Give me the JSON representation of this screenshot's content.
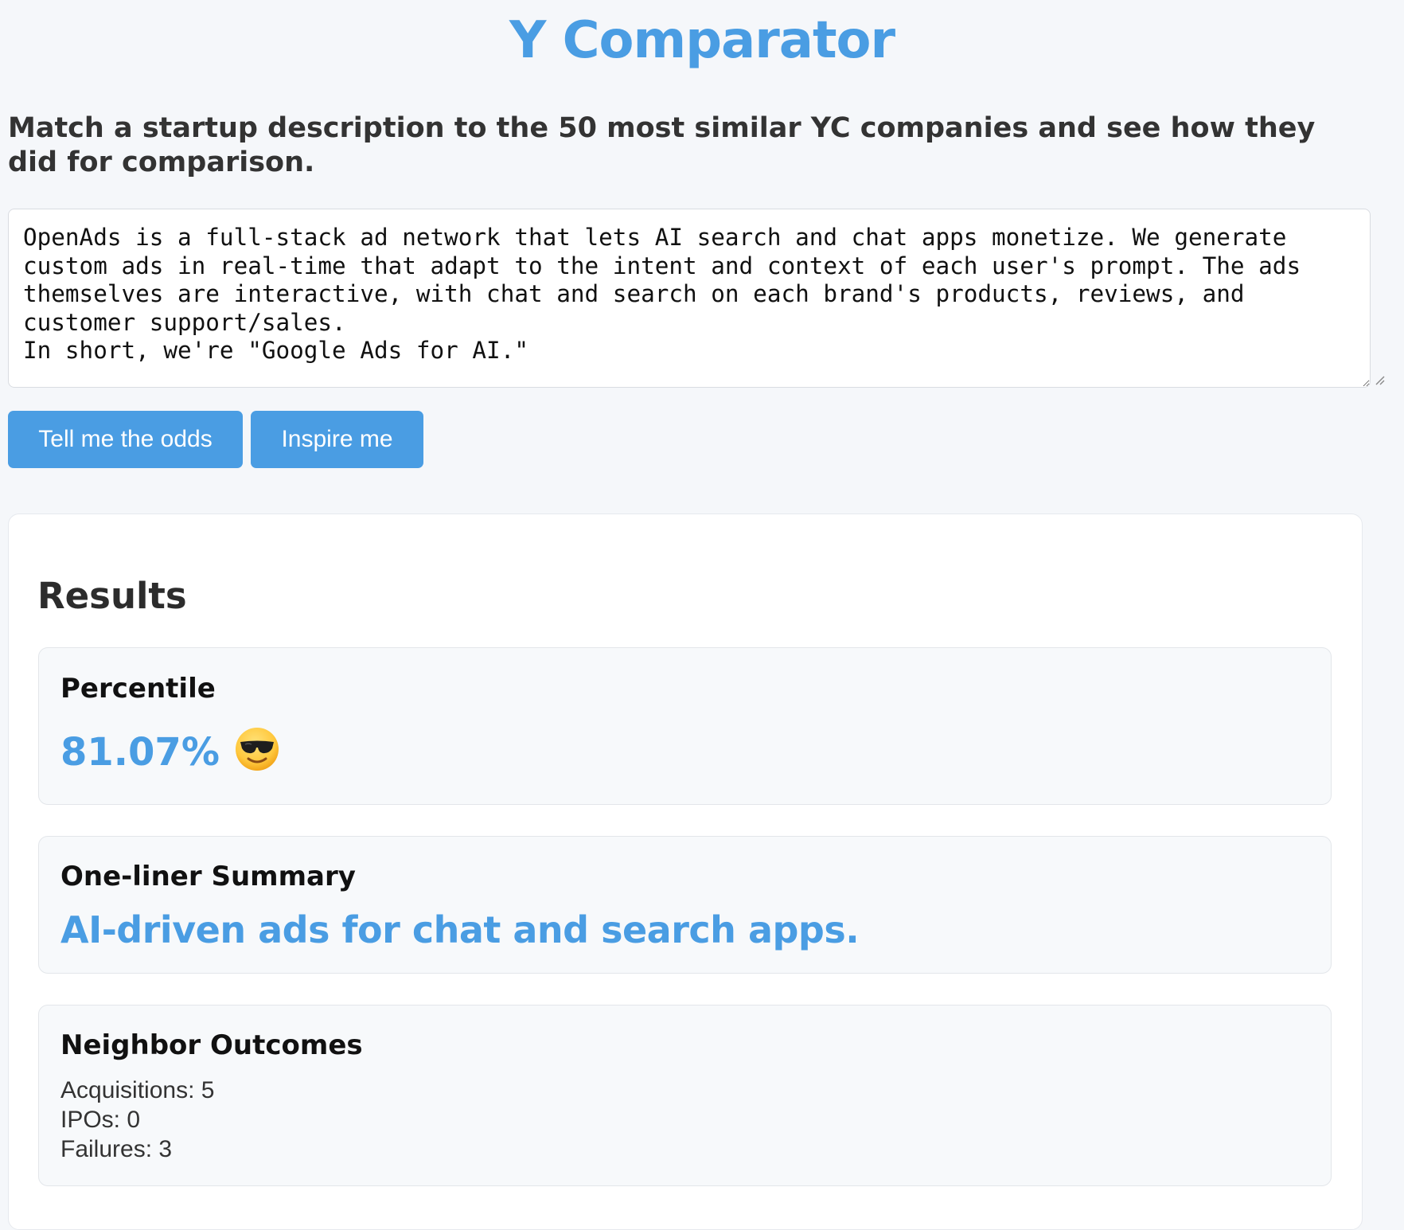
{
  "app": {
    "title": "Y Comparator",
    "subtitle": "Match a startup description to the 50 most similar YC companies and see how they did for comparison."
  },
  "input": {
    "description": "OpenAds is a full-stack ad network that lets AI search and chat apps monetize. We generate custom ads in real-time that adapt to the intent and context of each user's prompt. The ads themselves are interactive, with chat and search on each brand's products, reviews, and customer support/sales.\nIn short, we're \"Google Ads for AI.\""
  },
  "buttons": {
    "odds_label": "Tell me the odds",
    "inspire_label": "Inspire me"
  },
  "results": {
    "heading": "Results",
    "percentile": {
      "label": "Percentile",
      "value": "81.07%",
      "emoji_icon": "sunglasses-face-icon"
    },
    "summary": {
      "label": "One-liner Summary",
      "text": "AI-driven ads for chat and search apps."
    },
    "outcomes": {
      "label": "Neighbor Outcomes",
      "acquisitions": "Acquisitions: 5",
      "ipos": "IPOs: 0",
      "failures": "Failures: 3"
    }
  },
  "colors": {
    "accent": "#4a9de3",
    "background": "#f5f7fa"
  }
}
